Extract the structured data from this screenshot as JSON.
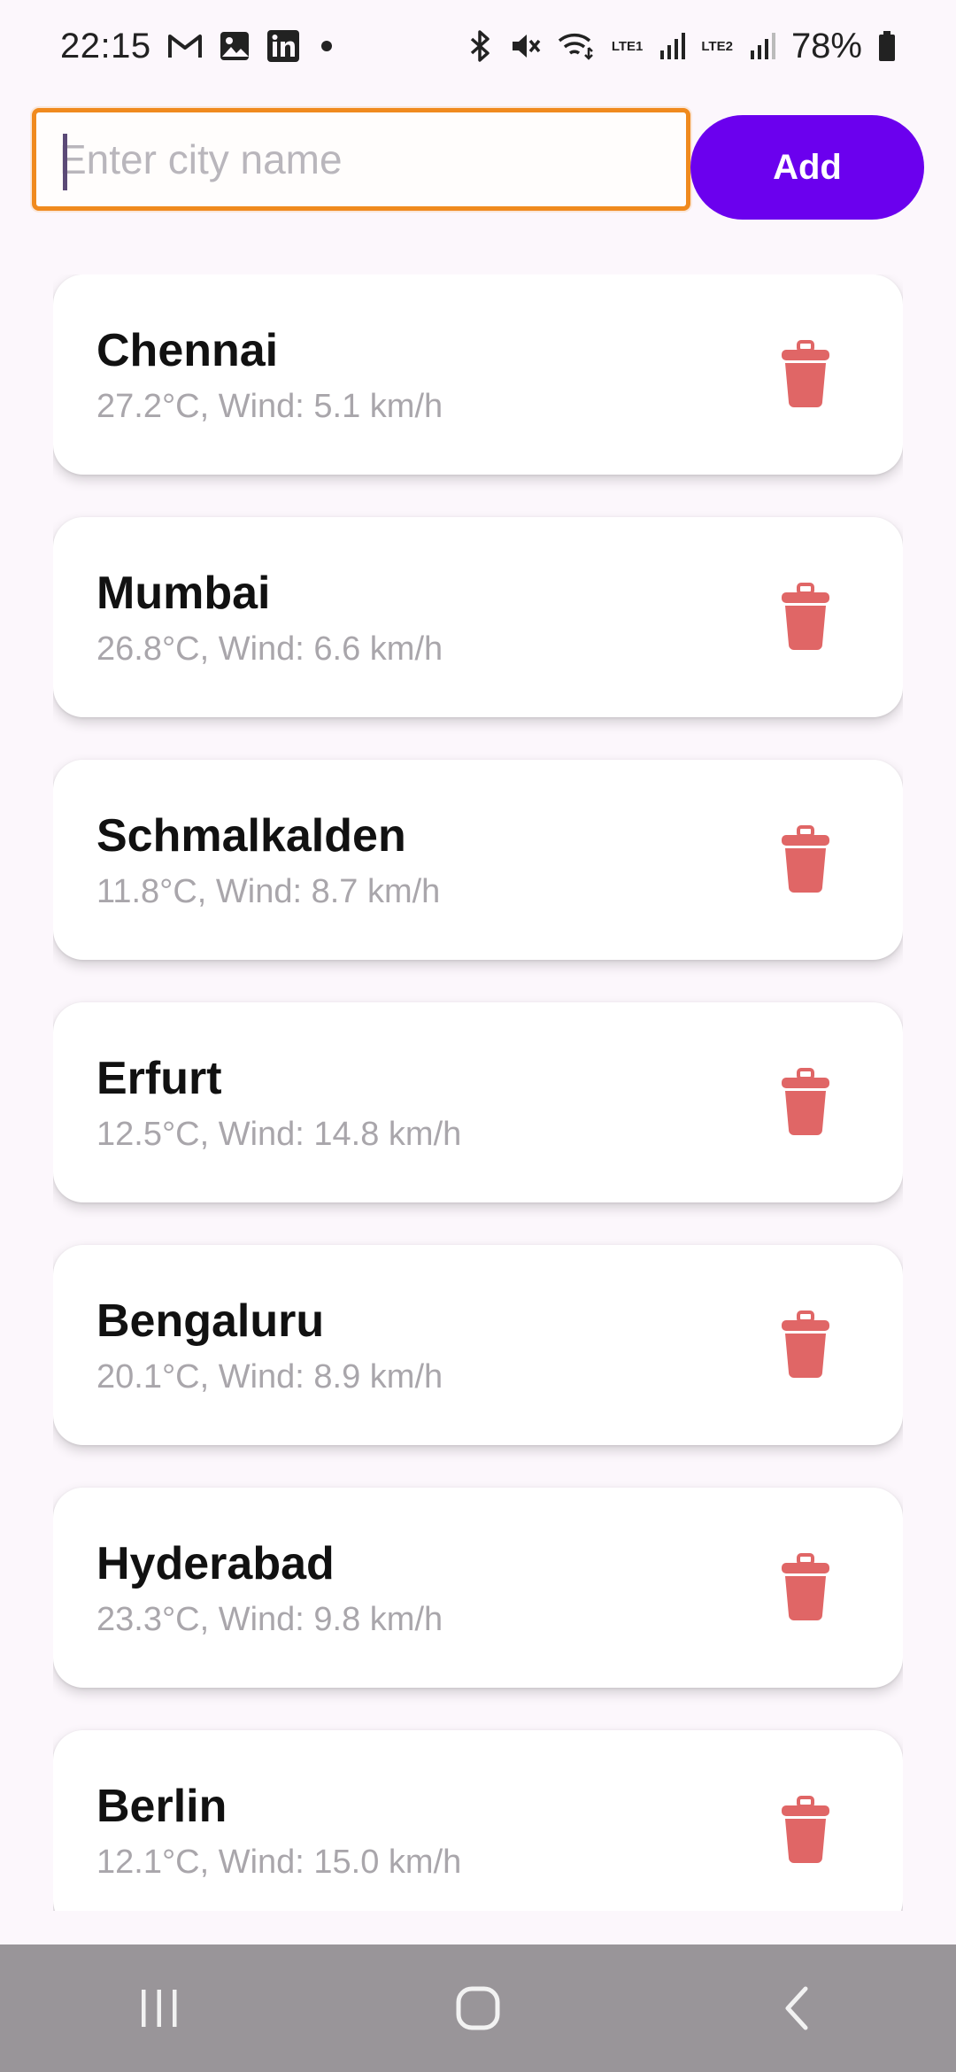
{
  "status_bar": {
    "time": "22:15",
    "battery": "78%",
    "net1": "LTE1",
    "net2": "LTE2",
    "left_icons": [
      "gmail-icon",
      "gallery-icon",
      "linkedin-icon",
      "dot-icon"
    ],
    "right_icons": [
      "bluetooth-icon",
      "mute-icon",
      "wifi-icon",
      "volte1-icon",
      "signal1-icon",
      "volte2-icon",
      "signal2-icon",
      "battery-icon"
    ]
  },
  "search": {
    "placeholder": "Enter city name",
    "value": "",
    "add_label": "Add"
  },
  "colors": {
    "accent": "#6B00EE",
    "input_border": "#F08A1E",
    "delete_icon": "#E06666",
    "background": "#FCF7FC"
  },
  "cities": [
    {
      "name": "Chennai",
      "weather": "27.2°C, Wind: 5.1 km/h"
    },
    {
      "name": "Mumbai",
      "weather": "26.8°C, Wind: 6.6 km/h"
    },
    {
      "name": "Schmalkalden",
      "weather": "11.8°C, Wind: 8.7 km/h"
    },
    {
      "name": "Erfurt",
      "weather": "12.5°C, Wind: 14.8 km/h"
    },
    {
      "name": "Bengaluru",
      "weather": "20.1°C, Wind: 8.9 km/h"
    },
    {
      "name": "Hyderabad",
      "weather": "23.3°C, Wind: 9.8 km/h"
    },
    {
      "name": "Berlin",
      "weather": "12.1°C, Wind: 15.0 km/h"
    }
  ],
  "nav": {
    "buttons": [
      "recent-apps-icon",
      "home-icon",
      "back-icon"
    ]
  }
}
